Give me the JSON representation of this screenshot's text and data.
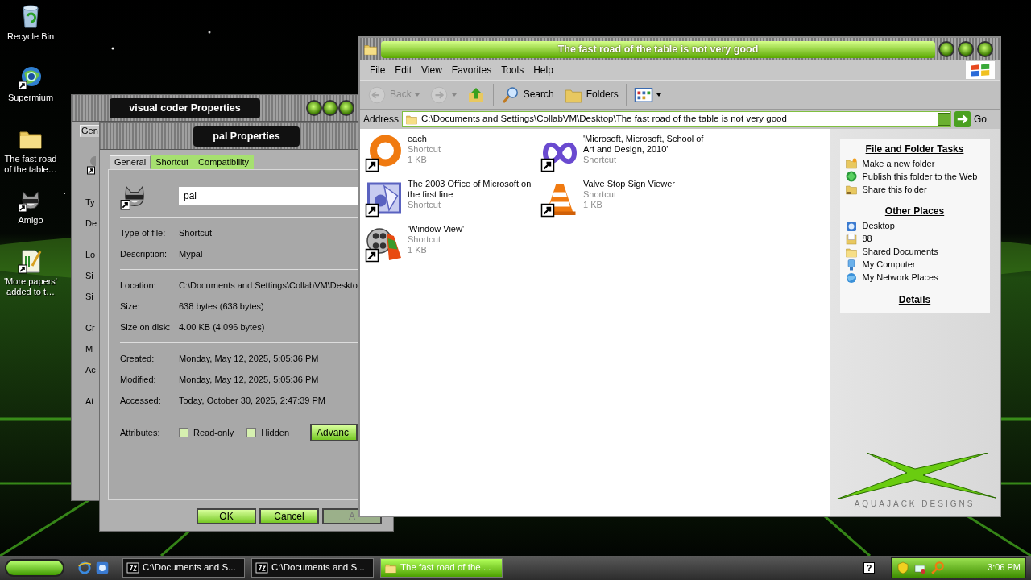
{
  "desktop_icons": [
    {
      "label": "Recycle Bin",
      "kind": "recycle",
      "shortcut": false
    },
    {
      "label": "Supermium",
      "kind": "globe",
      "shortcut": true
    },
    {
      "label": "The fast road of the table…",
      "kind": "folder",
      "shortcut": false
    },
    {
      "label": "Amigo",
      "kind": "raccoon",
      "shortcut": true
    },
    {
      "label": "'More papers' added to t…",
      "kind": "document",
      "shortcut": true
    }
  ],
  "background_window": {
    "title": "visual coder Properties",
    "active": false,
    "tab": "Gen",
    "labels": [
      "Ty",
      "De",
      "Lo",
      "Si",
      "Si",
      "Cr",
      "M",
      "Ac",
      "At"
    ]
  },
  "properties_window": {
    "title": "pal Properties",
    "active": false,
    "tabs": [
      {
        "label": "General",
        "selected": true
      },
      {
        "label": "Shortcut",
        "selected": false
      },
      {
        "label": "Compatibility",
        "selected": false
      }
    ],
    "name_value": "pal",
    "groups": [
      [
        {
          "label": "Type of file:",
          "value": "Shortcut"
        },
        {
          "label": "Description:",
          "value": "Mypal"
        }
      ],
      [
        {
          "label": "Location:",
          "value": "C:\\Documents and Settings\\CollabVM\\Deskto"
        },
        {
          "label": "Size:",
          "value": "638 bytes (638 bytes)"
        },
        {
          "label": "Size on disk:",
          "value": "4.00 KB (4,096 bytes)"
        }
      ],
      [
        {
          "label": "Created:",
          "value": "Monday, May 12, 2025, 5:05:36 PM"
        },
        {
          "label": "Modified:",
          "value": "Monday, May 12, 2025, 5:05:36 PM"
        },
        {
          "label": "Accessed:",
          "value": "Today, October 30, 2025, 2:47:39 PM"
        }
      ]
    ],
    "attributes_label": "Attributes:",
    "checkboxes": [
      {
        "label": "Read-only",
        "checked": false
      },
      {
        "label": "Hidden",
        "checked": false
      }
    ],
    "advanced_button": "Advanc",
    "buttons": [
      {
        "label": "OK",
        "disabled": false
      },
      {
        "label": "Cancel",
        "disabled": false
      },
      {
        "label": "A",
        "disabled": true
      }
    ]
  },
  "explorer": {
    "title": "The fast road of the table is not very good",
    "active": true,
    "menu": [
      "File",
      "Edit",
      "View",
      "Favorites",
      "Tools",
      "Help"
    ],
    "toolbar": [
      {
        "kind": "back",
        "label": "Back",
        "disabled": true
      },
      {
        "kind": "forward",
        "disabled": true
      },
      {
        "kind": "up",
        "disabled": false
      },
      {
        "kind": "search",
        "label": "Search",
        "disabled": false
      },
      {
        "kind": "folders",
        "label": "Folders",
        "disabled": false
      },
      {
        "kind": "views",
        "disabled": false
      }
    ],
    "address_label": "Address",
    "address": "C:\\Documents and Settings\\CollabVM\\Desktop\\The fast road of the table is not very good",
    "go": "Go",
    "items": [
      {
        "name": "each",
        "type": "Shortcut",
        "size": "1 KB",
        "kind": "ring"
      },
      {
        "name": "'Microsoft, Microsoft, School of Art and Design, 2010'",
        "type": "Shortcut",
        "kind": "infinity"
      },
      {
        "name": "The 2003 Office of Microsoft on the first line",
        "type": "Shortcut",
        "kind": "office"
      },
      {
        "name": "Valve Stop Sign Viewer",
        "type": "Shortcut",
        "size": "1 KB",
        "kind": "cone"
      },
      {
        "name": "'Window View'",
        "type": "Shortcut",
        "size": "1 KB",
        "kind": "film"
      }
    ],
    "sections": [
      {
        "title": "File and Folder Tasks",
        "links": [
          {
            "label": "Make a new folder",
            "kind": "newfolder"
          },
          {
            "label": "Publish this folder to the Web",
            "kind": "web"
          },
          {
            "label": "Share this folder",
            "kind": "share"
          }
        ]
      },
      {
        "title": "Other Places",
        "links": [
          {
            "label": "Desktop",
            "kind": "desktop"
          },
          {
            "label": "88",
            "kind": "docs"
          },
          {
            "label": "Shared Documents",
            "kind": "folder"
          },
          {
            "label": "My Computer",
            "kind": "computer"
          },
          {
            "label": "My Network Places",
            "kind": "network"
          }
        ]
      },
      {
        "title": "Details"
      }
    ],
    "logo_caption": "AQUAJACK DESIGNS"
  },
  "taskbar": {
    "tasks": [
      {
        "label": "C:\\Documents and S...",
        "kind": "archive",
        "selected": false
      },
      {
        "label": "C:\\Documents and S...",
        "kind": "archive",
        "selected": false
      },
      {
        "label": "The fast road of the ...",
        "kind": "folder",
        "selected": true
      }
    ],
    "help": "?",
    "clock": "3:06 PM"
  }
}
